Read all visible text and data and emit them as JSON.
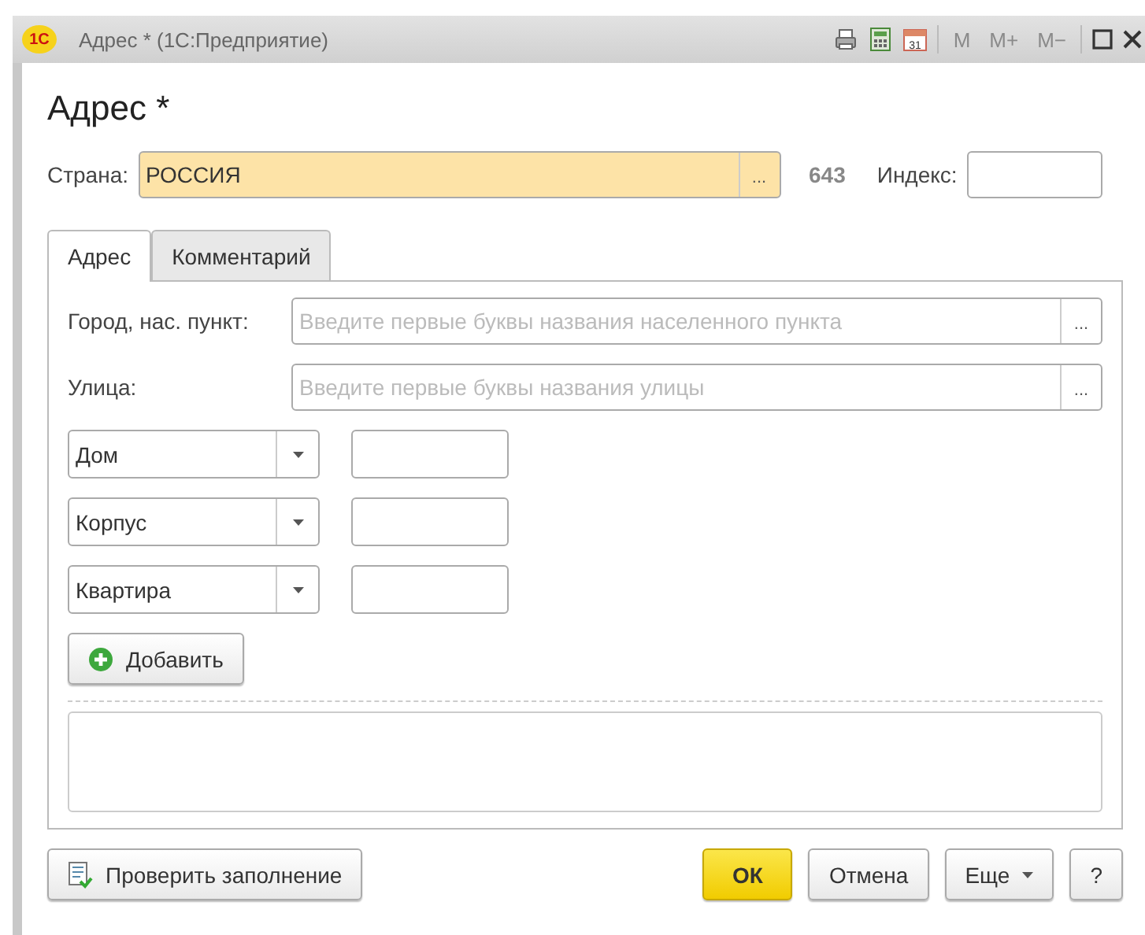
{
  "window": {
    "logo": "1С",
    "title": "Адрес * (1С:Предприятие)",
    "tools": [
      {
        "kind": "printer"
      },
      {
        "kind": "calculator"
      },
      {
        "kind": "calendar",
        "label": "31"
      }
    ],
    "memory_buttons": [
      {
        "label": "M",
        "disabled": true
      },
      {
        "label": "M+",
        "disabled": true
      },
      {
        "label": "M−",
        "disabled": true
      }
    ]
  },
  "heading": "Адрес *",
  "country": {
    "label": "Страна:",
    "value": "РОССИЯ",
    "button": "...",
    "code": "643"
  },
  "index": {
    "label": "Индекс:"
  },
  "tabs": [
    {
      "label": "Адрес",
      "selected": true
    },
    {
      "label": "Комментарий",
      "selected": false
    }
  ],
  "fields": [
    {
      "label": "Город, нас. пункт:",
      "placeholder": "Введите первые буквы названия населенного пункта",
      "button": "..."
    },
    {
      "label": "Улица:",
      "placeholder": "Введите первые буквы названия улицы",
      "button": "..."
    }
  ],
  "parts": [
    {
      "type": "Дом"
    },
    {
      "type": "Корпус"
    },
    {
      "type": "Квартира"
    }
  ],
  "add_button": "Добавить",
  "buttons": [
    {
      "kind": "check",
      "label": "Проверить заполнение"
    },
    {
      "kind": "default",
      "label": "ОК"
    },
    {
      "kind": "plain",
      "label": "Отмена"
    },
    {
      "kind": "menu",
      "label": "Еще"
    },
    {
      "kind": "plain",
      "label": "?"
    }
  ]
}
